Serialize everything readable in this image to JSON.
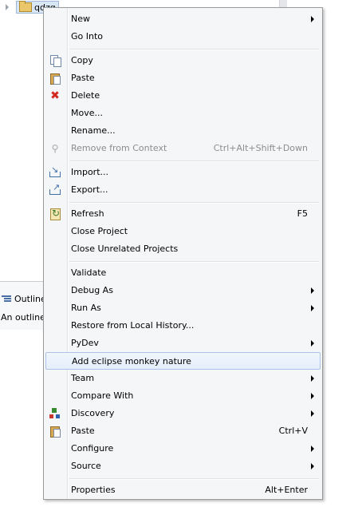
{
  "tree": {
    "project_name": "qdzq"
  },
  "outline": {
    "tab_label": "Outline",
    "message": "An outline"
  },
  "menu": {
    "items": [
      {
        "label": "New",
        "submenu": true
      },
      {
        "label": "Go Into"
      },
      {
        "label": "Copy",
        "icon": "copy-icon"
      },
      {
        "label": "Paste",
        "icon": "paste-icon"
      },
      {
        "label": "Delete",
        "icon": "delete-icon"
      },
      {
        "label": "Move..."
      },
      {
        "label": "Rename..."
      },
      {
        "label": "Remove from Context",
        "accelerator": "Ctrl+Alt+Shift+Down",
        "disabled": true,
        "icon": "remove-context-icon"
      },
      {
        "label": "Import...",
        "icon": "import-icon"
      },
      {
        "label": "Export...",
        "icon": "export-icon"
      },
      {
        "label": "Refresh",
        "accelerator": "F5",
        "icon": "refresh-icon"
      },
      {
        "label": "Close Project"
      },
      {
        "label": "Close Unrelated Projects"
      },
      {
        "label": "Validate"
      },
      {
        "label": "Debug As",
        "submenu": true
      },
      {
        "label": "Run As",
        "submenu": true
      },
      {
        "label": "Restore from Local History..."
      },
      {
        "label": "PyDev",
        "submenu": true
      },
      {
        "label": "Add eclipse monkey nature",
        "highlighted": true
      },
      {
        "label": "Team",
        "submenu": true
      },
      {
        "label": "Compare With",
        "submenu": true
      },
      {
        "label": "Discovery",
        "submenu": true,
        "icon": "discovery-icon"
      },
      {
        "label": "Paste",
        "accelerator": "Ctrl+V",
        "icon": "paste-icon"
      },
      {
        "label": "Configure",
        "submenu": true
      },
      {
        "label": "Source",
        "submenu": true
      },
      {
        "label": "Properties",
        "accelerator": "Alt+Enter"
      }
    ]
  },
  "colors": {
    "menu_bg": "#f5f6f7",
    "highlight_border": "#a9c4e8",
    "disabled_text": "#8d8d8d",
    "delete_red": "#d12a1e"
  }
}
